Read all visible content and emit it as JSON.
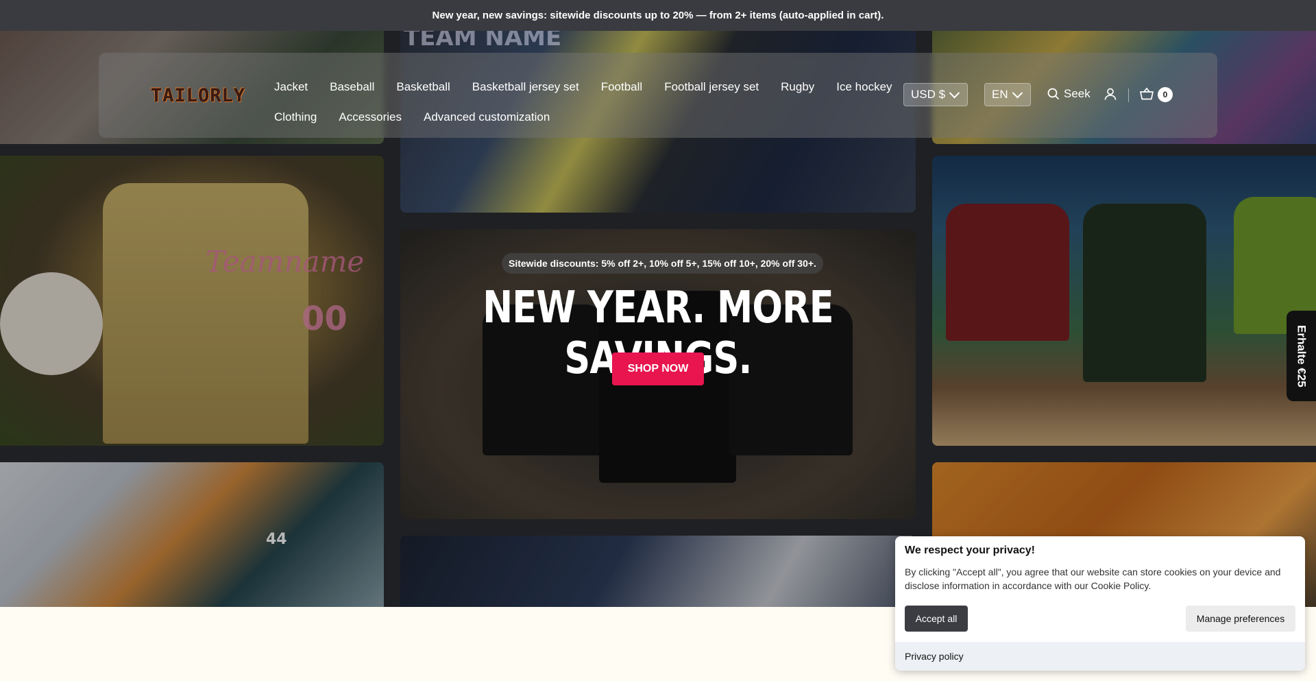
{
  "announcement": "New year, new savings: sitewide discounts up to 20% — from 2+ items (auto-applied in cart).",
  "header": {
    "logo_text": "TAILORLY",
    "nav_row1": [
      "Jacket",
      "Baseball",
      "Basketball",
      "Basketball jersey set",
      "Football",
      "Football jersey set",
      "Rugby",
      "Ice hockey"
    ],
    "nav_row2": [
      "Clothing",
      "Accessories",
      "Advanced customization"
    ],
    "currency": "USD $",
    "language": "EN",
    "search_label": "Seek",
    "cart_count": "0"
  },
  "tiles": {
    "baseball_jersey_text": "Teamname",
    "baseball_jersey_number": "00",
    "hockey_number": "44",
    "center_top_text": "TEAM NAME"
  },
  "promo": {
    "pill": "Sitewide discounts: 5% off 2+, 10% off 5+, 15% off 10+, 20% off 30+.",
    "title": "NEW YEAR. MORE SAVINGS.",
    "button": "SHOP NOW"
  },
  "side_tab": "Erhalte €25",
  "cookie": {
    "title": "We respect your privacy!",
    "body": "By clicking \"Accept all\", you agree that our website can store cookies on your device and disclose information in accordance with our Cookie Policy.",
    "accept": "Accept all",
    "manage": "Manage preferences",
    "privacy": "Privacy policy"
  },
  "colors": {
    "accent": "#e8154f",
    "announce_bg": "#3a3b40",
    "page_bg": "#fffcf4"
  }
}
